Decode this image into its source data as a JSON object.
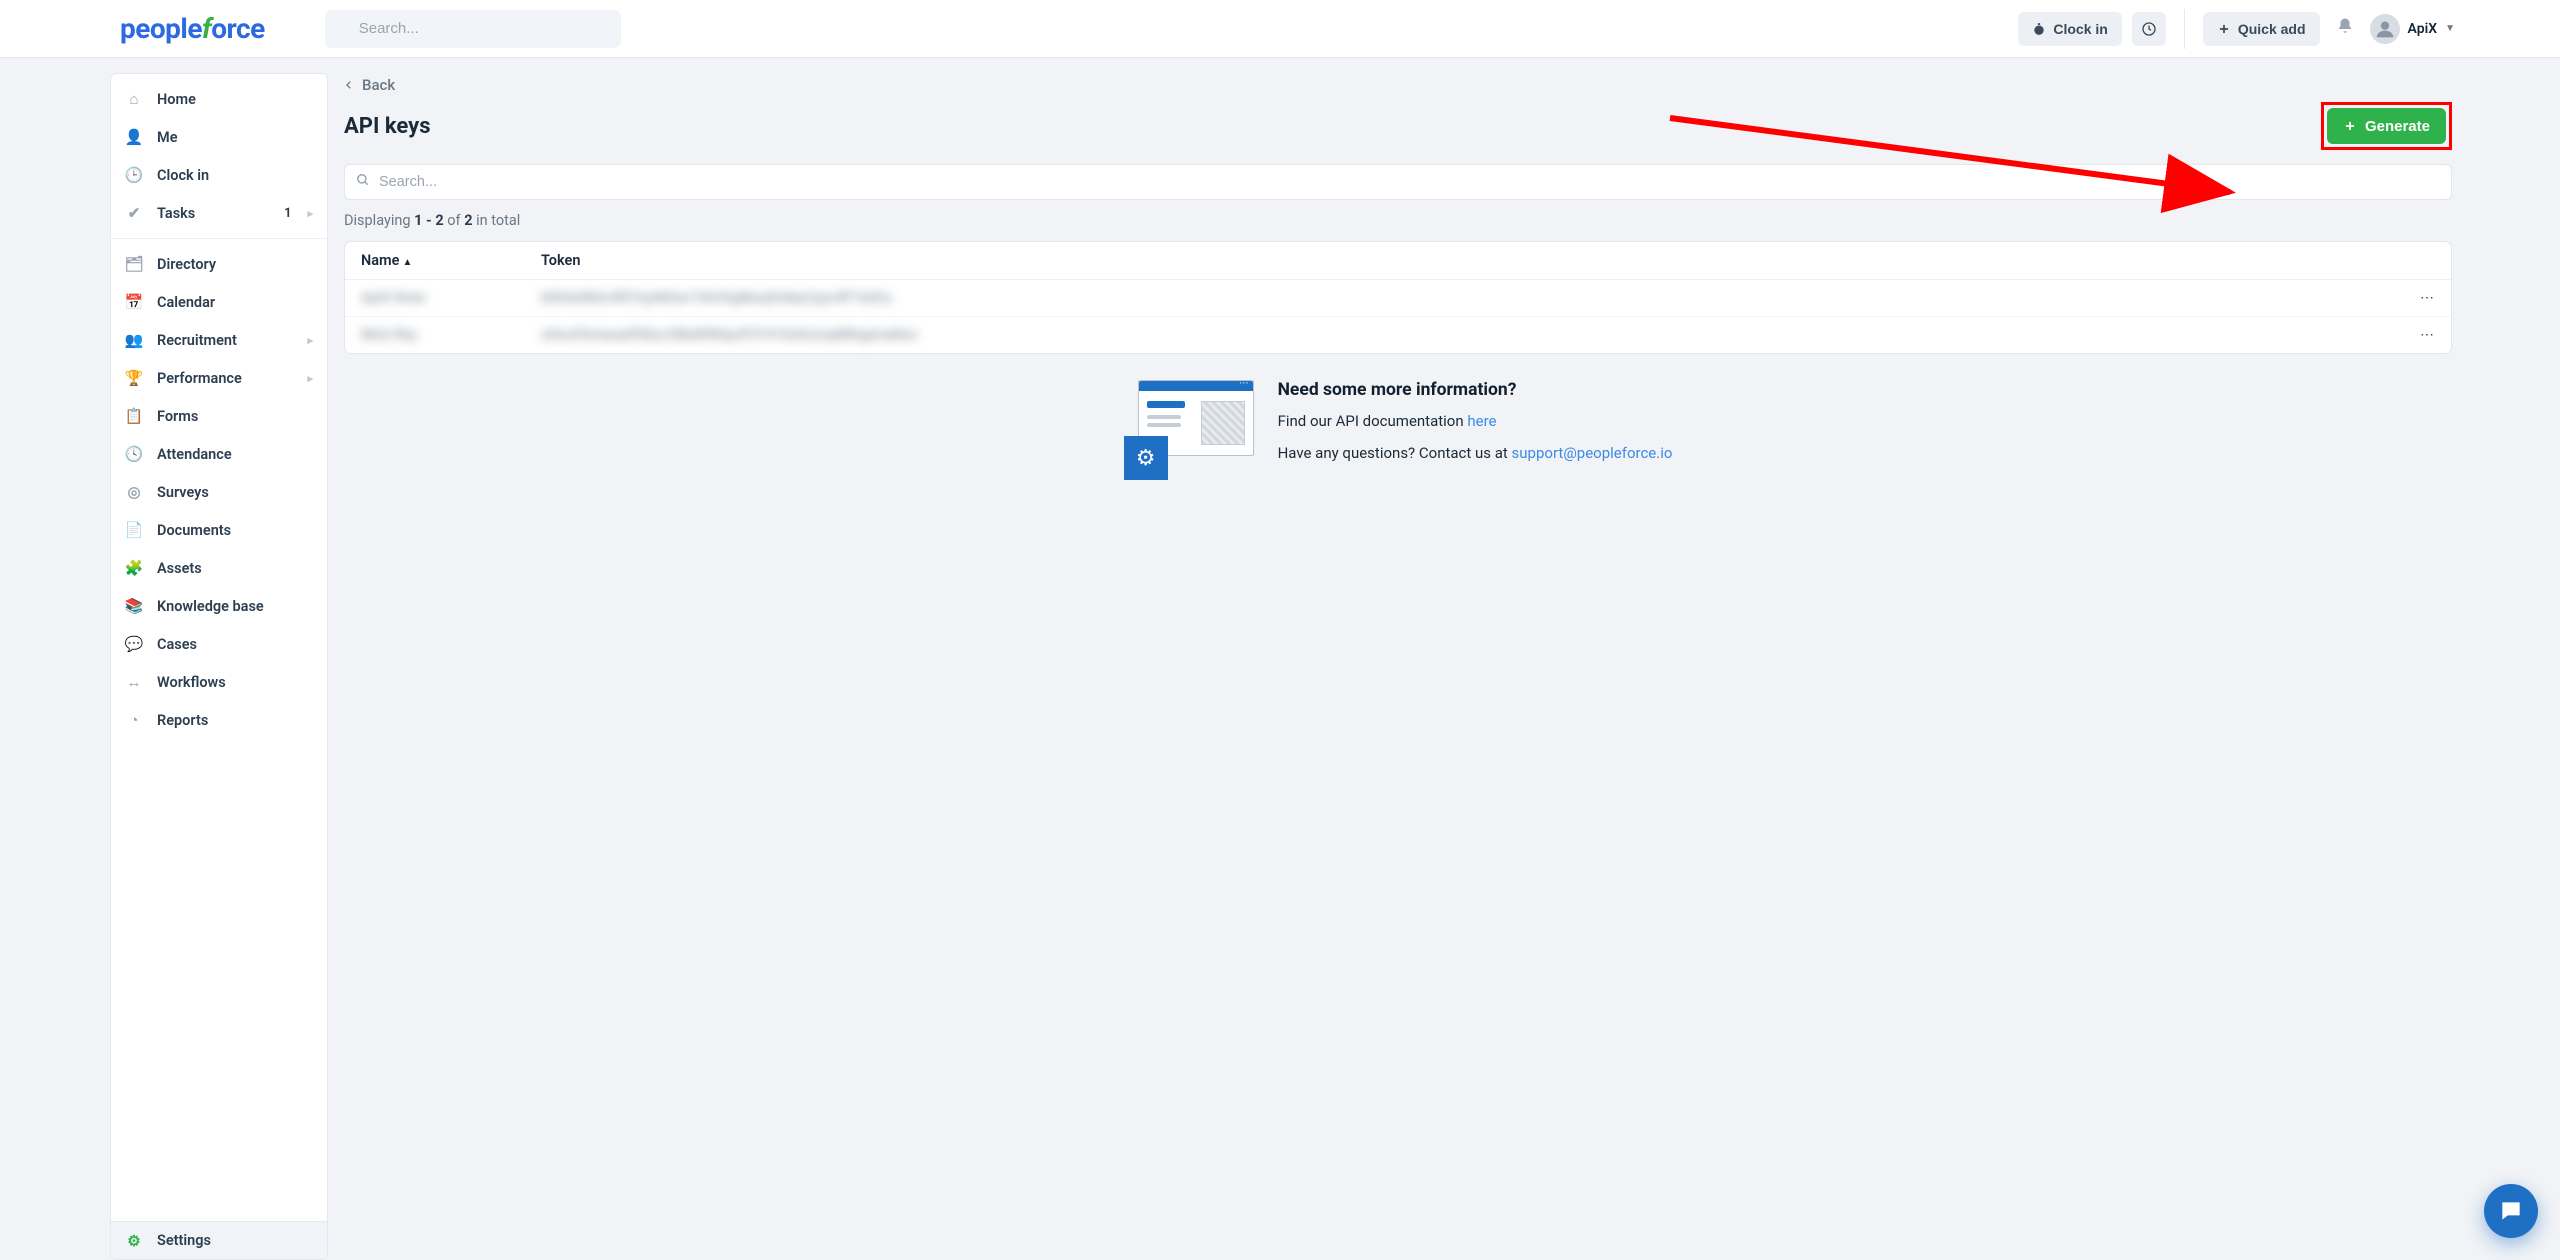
{
  "header": {
    "logo": {
      "part1": "people",
      "part2": "f",
      "part3": "orce"
    },
    "search_placeholder": "Search...",
    "clock_in_label": "Clock in",
    "quick_add_label": "Quick add",
    "user_name": "ApiX"
  },
  "sidebar": {
    "group1": [
      {
        "icon": "home-icon",
        "glyph": "⌂",
        "label": "Home"
      },
      {
        "icon": "person-icon",
        "glyph": "👤",
        "label": "Me"
      },
      {
        "icon": "clock-icon",
        "glyph": "🕒",
        "label": "Clock in"
      },
      {
        "icon": "check-icon",
        "glyph": "✔",
        "label": "Tasks",
        "badge": "1",
        "chevron": true
      }
    ],
    "group2": [
      {
        "icon": "id-icon",
        "glyph": "🗂",
        "label": "Directory"
      },
      {
        "icon": "calendar-icon",
        "glyph": "📅",
        "label": "Calendar"
      },
      {
        "icon": "people-icon",
        "glyph": "👥",
        "label": "Recruitment",
        "chevron": true
      },
      {
        "icon": "trophy-icon",
        "glyph": "🏆",
        "label": "Performance",
        "chevron": true
      },
      {
        "icon": "clipboard-icon",
        "glyph": "📋",
        "label": "Forms"
      },
      {
        "icon": "clock2-icon",
        "glyph": "🕓",
        "label": "Attendance"
      },
      {
        "icon": "survey-icon",
        "glyph": "◎",
        "label": "Surveys"
      },
      {
        "icon": "doc-icon",
        "glyph": "📄",
        "label": "Documents"
      },
      {
        "icon": "assets-icon",
        "glyph": "🧩",
        "label": "Assets"
      },
      {
        "icon": "book-icon",
        "glyph": "📚",
        "label": "Knowledge base"
      },
      {
        "icon": "cases-icon",
        "glyph": "💬",
        "label": "Cases"
      },
      {
        "icon": "workflow-icon",
        "glyph": "↔",
        "label": "Workflows"
      },
      {
        "icon": "chart-icon",
        "glyph": "◔",
        "label": "Reports"
      }
    ],
    "settings": {
      "icon": "gear-icon",
      "glyph": "⚙",
      "label": "Settings"
    }
  },
  "main": {
    "back_label": "Back",
    "page_title": "API keys",
    "generate_label": "Generate",
    "search_placeholder": "Search...",
    "count": {
      "prefix": "Displaying ",
      "range": "1 - 2",
      "of": " of ",
      "total": "2",
      "suffix": " in total"
    },
    "table": {
      "col_name": "Name",
      "col_token": "Token",
      "rows": [
        {
          "name": "ApiX three",
          "token": "k0h5a9b0c4f07ey4k0wr7i4mfrgl8esj5v8ey2zpc4P7s6Ou"
        },
        {
          "name": "Mick Rey",
          "token": "s0wof3miasa0f3bsv30kd0f84yzP2Y410z0s2sq8iRegimaNzo"
        }
      ]
    },
    "info": {
      "heading": "Need some more information?",
      "line1_prefix": "Find our API documentation ",
      "line1_link": "here",
      "line2_prefix": "Have any questions? Contact us at ",
      "line2_link": "support@peopleforce.io"
    }
  }
}
